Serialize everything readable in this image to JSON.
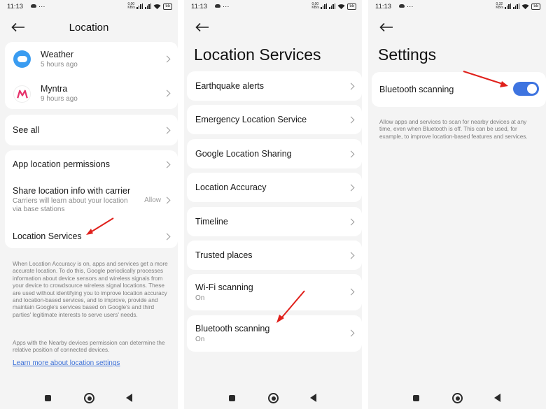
{
  "status_bar": {
    "time": "11:13",
    "dots": "···",
    "net_speed_1": "0.00",
    "net_speed_2": "0.32",
    "net_unit": "KB/s",
    "battery": "55"
  },
  "screen1": {
    "title": "Location",
    "recent_apps": [
      {
        "name": "Weather",
        "time": "5 hours ago",
        "icon": "weather-icon"
      },
      {
        "name": "Myntra",
        "time": "9 hours ago",
        "icon": "myntra-icon"
      }
    ],
    "see_all": "See all",
    "settings": {
      "app_permissions": "App location permissions",
      "share_carrier": "Share location info with carrier",
      "share_carrier_desc": "Carriers will learn about your location via base stations",
      "share_carrier_value": "Allow",
      "location_services": "Location Services"
    },
    "description": "When Location Accuracy is on, apps and services get a more accurate location. To do this, Google periodically processes information about device sensors and wireless signals from your device to crowdsource wireless signal locations. These are used without identifying you to improve location accuracy and location-based services, and to improve, provide and maintain Google's services based on Google's and third parties' legitimate interests to serve users' needs.",
    "nearby_note": "Apps with the Nearby devices permission can determine the relative position of connected devices.",
    "learn_more": "Learn more about location settings"
  },
  "screen2": {
    "title": "Location Services",
    "items": [
      {
        "label": "Earthquake alerts"
      },
      {
        "label": "Emergency Location Service"
      },
      {
        "label": "Google Location Sharing"
      },
      {
        "label": "Location Accuracy"
      },
      {
        "label": "Timeline"
      },
      {
        "label": "Trusted places"
      },
      {
        "label": "Wi-Fi scanning",
        "sub": "On"
      },
      {
        "label": "Bluetooth scanning",
        "sub": "On"
      }
    ]
  },
  "screen3": {
    "title": "Settings",
    "toggle_label": "Bluetooth scanning",
    "toggle_on": true,
    "description": "Allow apps and services to scan for nearby devices at any time, even when Bluetooth is off. This can be used, for example, to improve location-based features and services."
  },
  "colors": {
    "accent": "#3e74e0",
    "arrow": "#e0201b",
    "link": "#3a6fd8"
  }
}
